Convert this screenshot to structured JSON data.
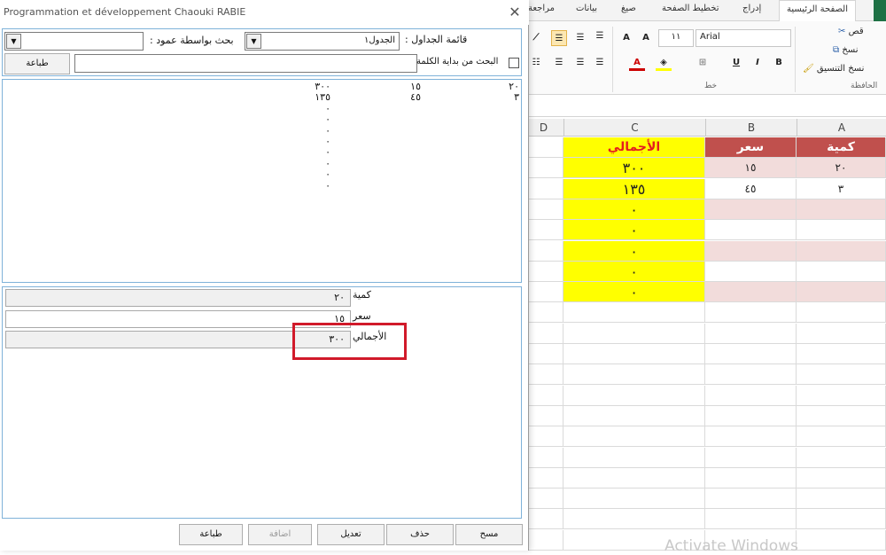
{
  "excel": {
    "tabs": [
      "مراجعة",
      "بيانات",
      "صيغ",
      "تخطيط الصفحة",
      "إدراج",
      "الصفحة الرئيسية"
    ],
    "clipboard": {
      "cut": "قص",
      "copy": "نسخ",
      "format_painter": "نسخ التنسيق",
      "group_label": "الحافظة"
    },
    "font": {
      "name": "Arial",
      "size": "١١",
      "group_label": "خط"
    },
    "columns": [
      "D",
      "C",
      "B",
      "A"
    ],
    "headers": {
      "a": "كمية",
      "b": "سعر",
      "c": "الأجمالي"
    },
    "rows": [
      {
        "a": "٢٠",
        "b": "١٥",
        "c": "٣٠٠"
      },
      {
        "a": "٣",
        "b": "٤٥",
        "c": "١٣٥"
      },
      {
        "a": "",
        "b": "",
        "c": "٠"
      },
      {
        "a": "",
        "b": "",
        "c": "٠"
      },
      {
        "a": "",
        "b": "",
        "c": "٠"
      },
      {
        "a": "",
        "b": "",
        "c": "٠"
      },
      {
        "a": "",
        "b": "",
        "c": "٠"
      }
    ],
    "watermark": "Activate Windows",
    "colors": {
      "header_red": "#c0504d",
      "header_yellow": "#ffff00",
      "pink_row": "#f2dcdb",
      "title_red": "#e41e1e"
    }
  },
  "dialog": {
    "title": "Programmation et développement Chaouki RABIE",
    "close_icon": "close-icon",
    "search": {
      "table_list_label": "قائمة الجداول :",
      "table_list_value": "الجدول١",
      "column_search_label": "بحث بواسطة عمود :",
      "column_search_value": "",
      "start_of_word_label": "البحث من بداية الكلمة",
      "search_text": "",
      "print_label": "طباعة"
    },
    "list": {
      "rows": [
        {
          "c1": "٢٠",
          "c2": "١٥",
          "c3": "٣٠٠"
        },
        {
          "c1": "٣",
          "c2": "٤٥",
          "c3": "١٣٥"
        },
        {
          "c1": "",
          "c2": "",
          "c3": "٠"
        },
        {
          "c1": "",
          "c2": "",
          "c3": "٠"
        },
        {
          "c1": "",
          "c2": "",
          "c3": "٠"
        },
        {
          "c1": "",
          "c2": "",
          "c3": "٠"
        },
        {
          "c1": "",
          "c2": "",
          "c3": "٠"
        },
        {
          "c1": "",
          "c2": "",
          "c3": "٠"
        },
        {
          "c1": "",
          "c2": "",
          "c3": "٠"
        },
        {
          "c1": "",
          "c2": "",
          "c3": "٠"
        }
      ]
    },
    "detail": {
      "fields": [
        {
          "label": "كمية",
          "value": "٢٠"
        },
        {
          "label": "سعر",
          "value": "١٥"
        },
        {
          "label": "الأجمالي",
          "value": "٣٠٠"
        }
      ]
    },
    "buttons": {
      "clear": "مسح",
      "delete": "حذف",
      "edit": "تعديل",
      "add": "اضافة",
      "print": "طباعة"
    },
    "highlight_color": "#d11a2a"
  }
}
